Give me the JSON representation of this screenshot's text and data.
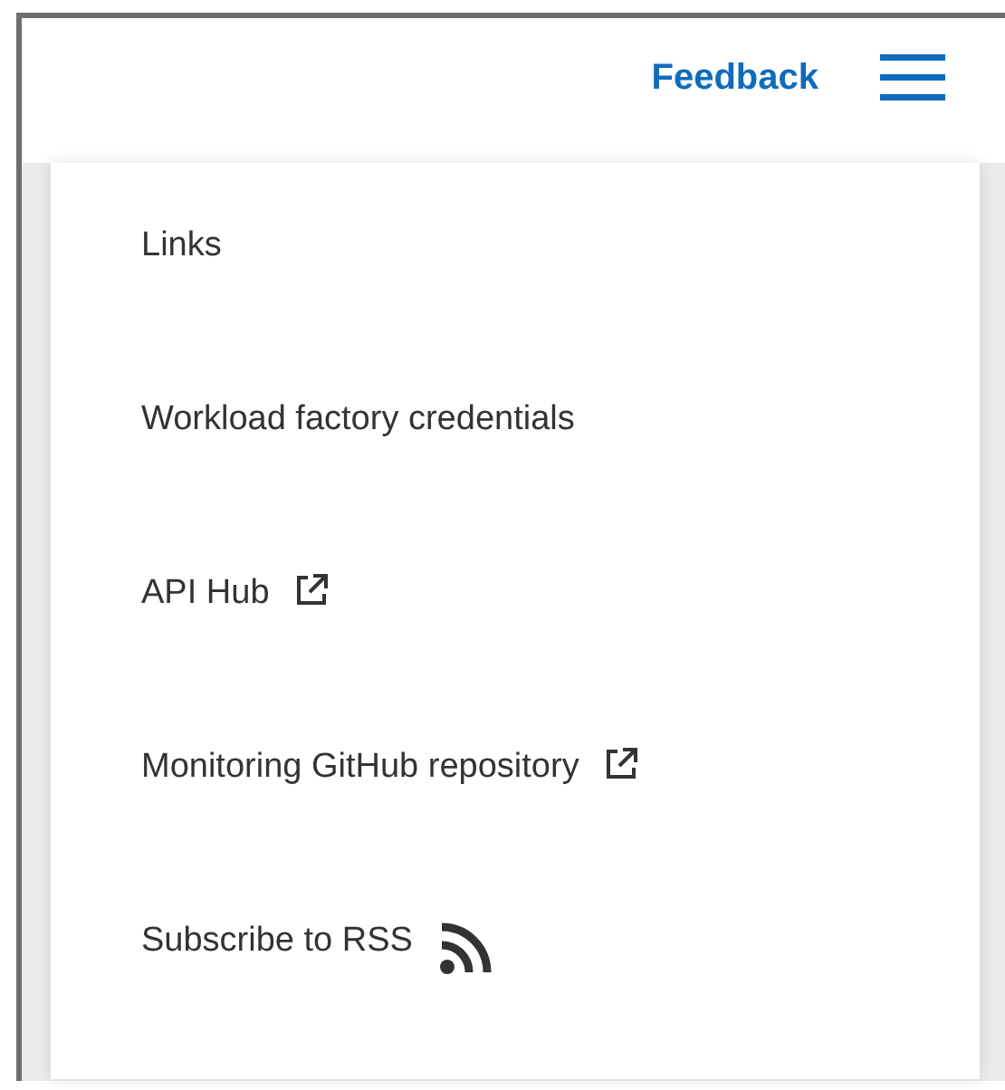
{
  "header": {
    "feedback": "Feedback"
  },
  "menu": {
    "items": [
      {
        "label": "Links",
        "kind": "plain"
      },
      {
        "label": "Workload factory credentials",
        "kind": "plain"
      },
      {
        "label": "API Hub",
        "kind": "external"
      },
      {
        "label": "Monitoring GitHub repository",
        "kind": "external"
      },
      {
        "label": "Subscribe to RSS",
        "kind": "rss"
      }
    ]
  }
}
